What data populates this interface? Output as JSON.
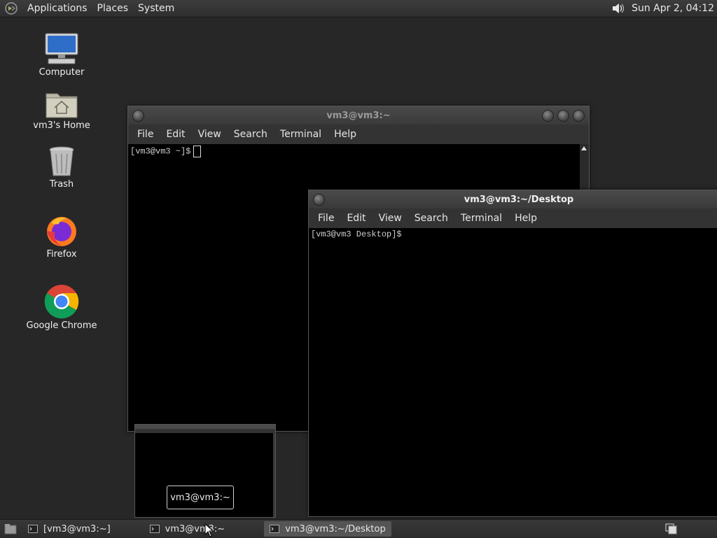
{
  "top_panel": {
    "menus": [
      "Applications",
      "Places",
      "System"
    ],
    "clock": "Sun Apr  2, 04:12"
  },
  "desktop_icons": [
    {
      "label": "Computer",
      "icon": "computer-icon"
    },
    {
      "label": "vm3's Home",
      "icon": "home-folder-icon"
    },
    {
      "label": "Trash",
      "icon": "trash-icon"
    },
    {
      "label": "Firefox",
      "icon": "firefox-icon"
    },
    {
      "label": "Google Chrome",
      "icon": "chrome-icon"
    }
  ],
  "window_home": {
    "title": "vm3@vm3:~",
    "menu": [
      "File",
      "Edit",
      "View",
      "Search",
      "Terminal",
      "Help"
    ],
    "prompt": "[vm3@vm3 ~]$"
  },
  "window_desktop": {
    "title": "vm3@vm3:~/Desktop",
    "menu": [
      "File",
      "Edit",
      "View",
      "Search",
      "Terminal",
      "Help"
    ],
    "prompt": "[vm3@vm3 Desktop]$"
  },
  "tooltip": "vm3@vm3:~",
  "taskbar": {
    "tasks": [
      {
        "label": "[vm3@vm3:~]",
        "active": false
      },
      {
        "label": "vm3@vm3:~",
        "active": false
      },
      {
        "label": "vm3@vm3:~/Desktop",
        "active": true
      }
    ]
  },
  "colors": {
    "desktop_bg": "#272727",
    "panel": "#333333",
    "terminal_bg": "#000000"
  }
}
